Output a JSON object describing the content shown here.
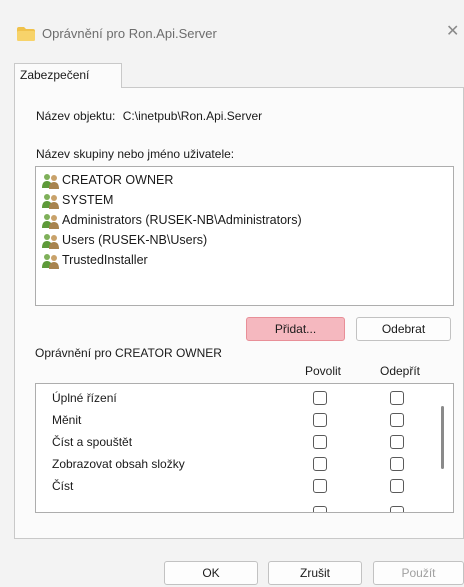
{
  "window": {
    "title": "Oprávnění pro Ron.Api.Server"
  },
  "tabs": [
    {
      "label": "Zabezpečení"
    }
  ],
  "object": {
    "label": "Název objektu:",
    "value": "C:\\inetpub\\Ron.Api.Server"
  },
  "groups": {
    "label": "Název skupiny nebo jméno uživatele:",
    "items": [
      {
        "label": "CREATOR OWNER",
        "icon": "users-icon"
      },
      {
        "label": "SYSTEM",
        "icon": "users-icon"
      },
      {
        "label": "Administrators (RUSEK-NB\\Administrators)",
        "icon": "users-icon"
      },
      {
        "label": "Users (RUSEK-NB\\Users)",
        "icon": "users-icon"
      },
      {
        "label": "TrustedInstaller",
        "icon": "users-icon"
      }
    ],
    "add_label": "Přidat...",
    "remove_label": "Odebrat"
  },
  "permissions": {
    "for_label": "Oprávnění pro CREATOR OWNER",
    "allow_header": "Povolit",
    "deny_header": "Odepřít",
    "rows": [
      {
        "label": "Úplné řízení",
        "allow": false,
        "deny": false
      },
      {
        "label": "Měnit",
        "allow": false,
        "deny": false
      },
      {
        "label": "Číst a spouštět",
        "allow": false,
        "deny": false
      },
      {
        "label": "Zobrazovat obsah složky",
        "allow": false,
        "deny": false
      },
      {
        "label": "Číst",
        "allow": false,
        "deny": false
      }
    ]
  },
  "footer": {
    "ok_label": "OK",
    "cancel_label": "Zrušit",
    "apply_label": "Použít"
  },
  "colors": {
    "add_button_highlight": "#f5b8bf",
    "folder": "#f0c24b",
    "user_icon": "#5e9a3a"
  }
}
